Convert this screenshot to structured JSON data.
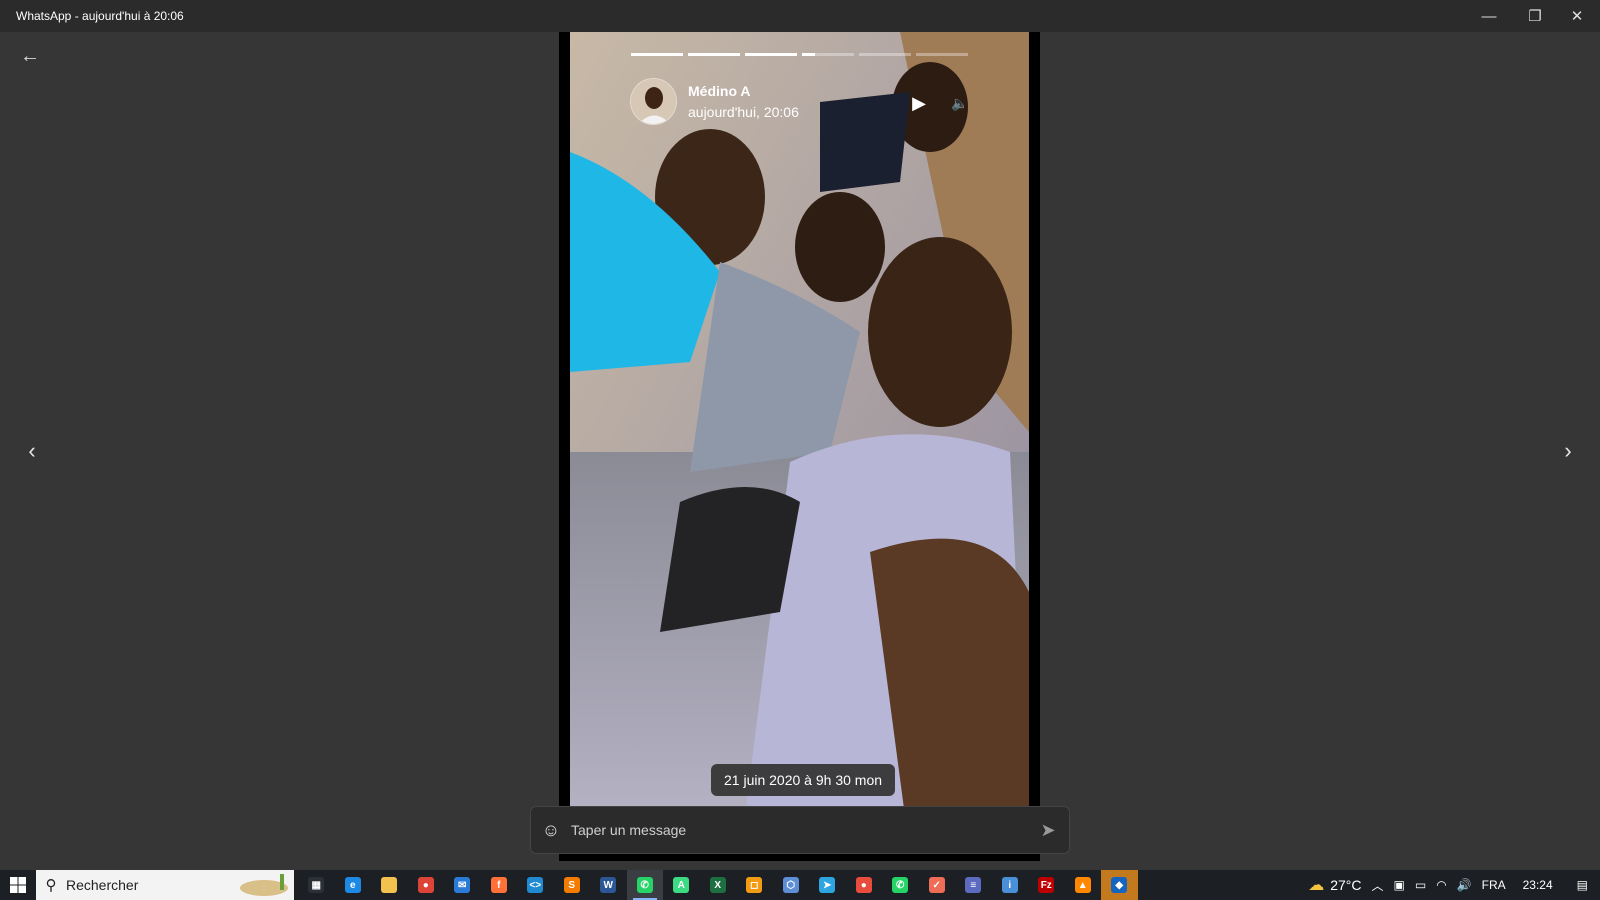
{
  "window": {
    "title": "WhatsApp - aujourd'hui à 20:06",
    "minimize_icon": "minimize-icon",
    "restore_icon": "restore-icon",
    "close_icon": "close-icon"
  },
  "viewer": {
    "back_icon": "arrow-left-icon",
    "prev_icon": "chevron-left-icon",
    "next_icon": "chevron-right-icon"
  },
  "story": {
    "author_name": "Médino A",
    "timestamp": "aujourd'hui, 20:06",
    "progress_segments": [
      1,
      1,
      1,
      0.25,
      0,
      0
    ],
    "caption": "21 juin 2020 à 9h 30 mon",
    "play_icon": "play-icon",
    "volume_icon": "volume-icon"
  },
  "composer": {
    "placeholder": "Taper un message",
    "emoji_icon": "emoji-icon",
    "send_icon": "send-icon"
  },
  "taskbar": {
    "search_placeholder": "Rechercher",
    "apps": [
      {
        "name": "task-view-icon",
        "color": "#2b2f36",
        "glyph": "▦"
      },
      {
        "name": "edge-icon",
        "color": "#1e88e5",
        "glyph": "e"
      },
      {
        "name": "file-explorer-icon",
        "color": "#f2c14e",
        "glyph": ""
      },
      {
        "name": "chrome-icon",
        "color": "#db4437",
        "glyph": "●"
      },
      {
        "name": "mail-icon",
        "color": "#2a7ad8",
        "glyph": "✉"
      },
      {
        "name": "firefox-icon",
        "color": "#ff7139",
        "glyph": "f"
      },
      {
        "name": "vscode-icon",
        "color": "#1f8ad2",
        "glyph": "<>"
      },
      {
        "name": "sublime-icon",
        "color": "#f57c00",
        "glyph": "S"
      },
      {
        "name": "word-icon",
        "color": "#2b5797",
        "glyph": "W"
      },
      {
        "name": "whatsapp-icon",
        "color": "#25d366",
        "glyph": "✆"
      },
      {
        "name": "android-studio-icon",
        "color": "#3ddc84",
        "glyph": "A"
      },
      {
        "name": "excel-icon",
        "color": "#1d6f42",
        "glyph": "X"
      },
      {
        "name": "orange-app-icon",
        "color": "#f39c12",
        "glyph": "◻"
      },
      {
        "name": "virtualbox-icon",
        "color": "#5e8fd6",
        "glyph": "⬡"
      },
      {
        "name": "telegram-icon",
        "color": "#2ca5e0",
        "glyph": "➤"
      },
      {
        "name": "media-app-icon",
        "color": "#e74c3c",
        "glyph": "●"
      },
      {
        "name": "whatsapp-alt-icon",
        "color": "#25d366",
        "glyph": "✆"
      },
      {
        "name": "app-icon",
        "color": "#ef6c57",
        "glyph": "✓"
      },
      {
        "name": "app-striped-icon",
        "color": "#5c6bc0",
        "glyph": "≡"
      },
      {
        "name": "app-circle-icon",
        "color": "#4a90d9",
        "glyph": "i"
      },
      {
        "name": "filezilla-icon",
        "color": "#bf0000",
        "glyph": "Fz"
      },
      {
        "name": "vlc-icon",
        "color": "#ff8800",
        "glyph": "▲"
      },
      {
        "name": "security-shield-icon",
        "color": "#1565c0",
        "glyph": "◆"
      }
    ],
    "weather_temp": "27°C",
    "language": "FRA",
    "clock": "23:24"
  }
}
